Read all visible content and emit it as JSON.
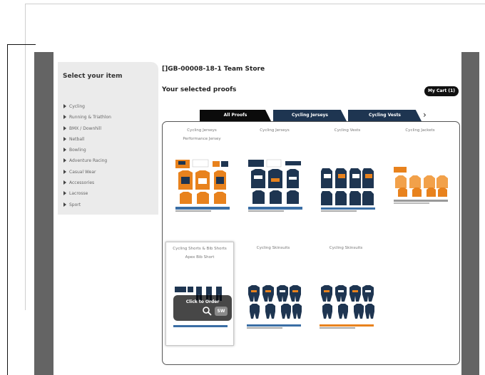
{
  "sidebar": {
    "heading": "Select your item",
    "items": [
      {
        "label": "Cycling"
      },
      {
        "label": "Running & Triathlon"
      },
      {
        "label": "BMX / Downhill"
      },
      {
        "label": "Netball"
      },
      {
        "label": "Bowling"
      },
      {
        "label": "Adventure Racing"
      },
      {
        "label": "Casual Wear"
      },
      {
        "label": "Accessories"
      },
      {
        "label": "Lacrosse"
      },
      {
        "label": "Sport"
      }
    ]
  },
  "header": {
    "store_title": "[]GB-00008-18-1  Team Store",
    "proofs_heading": "Your selected proofs",
    "cart_label": "My Cart (1)"
  },
  "tabs": [
    {
      "label": "All Proofs",
      "active": true
    },
    {
      "label": "Cycling Jerseys",
      "active": false
    },
    {
      "label": "Cycling Vests",
      "active": false
    }
  ],
  "tab_next_icon": "chevron-right-icon",
  "products": [
    {
      "category": "Cycling Jerseys",
      "name": "Performance Jersey",
      "theme": "orange"
    },
    {
      "category": "Cycling Jerseys",
      "name": "",
      "theme": "navy"
    },
    {
      "category": "Cycling Vests",
      "name": "",
      "theme": "navy-vest"
    },
    {
      "category": "Cycling Jackets",
      "name": "",
      "theme": "orange-light"
    },
    {
      "category": "Cycling Shorts & Bib Shorts",
      "name": "Apex Bib Short",
      "theme": "shorts"
    },
    {
      "category": "Cycling Skinsuits",
      "name": "",
      "theme": "skinsuit"
    },
    {
      "category": "Cycling Skinsuits",
      "name": "",
      "theme": "skinsuit"
    }
  ],
  "hover_overlay": {
    "label": "Click to Order",
    "zoom_icon": "magnify-icon",
    "badge": "SW"
  },
  "colors": {
    "navy": "#1e3551",
    "orange": "#e8821d",
    "gray_side": "#646464",
    "sidebar_bg": "#ebebeb"
  }
}
